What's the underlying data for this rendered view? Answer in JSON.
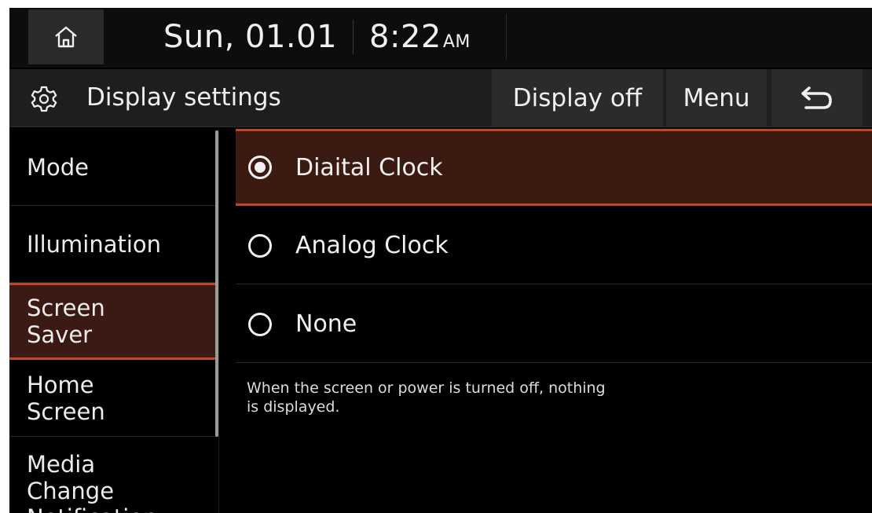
{
  "status_bar": {
    "home_icon": "home-icon",
    "date": "Sun, 01.01",
    "time": "8:22",
    "ampm": "AM"
  },
  "title_bar": {
    "settings_icon": "gear-icon",
    "title": "Display settings",
    "display_off_label": "Display off",
    "menu_label": "Menu",
    "back_icon": "back-arrow-icon"
  },
  "sidebar": {
    "items": [
      {
        "label": "Mode"
      },
      {
        "label": "Illumination"
      },
      {
        "label": "Screen\nSaver",
        "active": true
      },
      {
        "label": "Home\nScreen"
      },
      {
        "label": "Media\nChange\nNotification"
      }
    ]
  },
  "screen_saver": {
    "options": [
      {
        "label": "Diaital Clock",
        "selected": true
      },
      {
        "label": "Analog Clock",
        "selected": false
      },
      {
        "label": "None",
        "selected": false
      }
    ],
    "description": "When the screen or power is turned off, nothing\nis displayed."
  },
  "colors": {
    "accent": "#c0462a",
    "selected_bg": "#3b1a12"
  }
}
